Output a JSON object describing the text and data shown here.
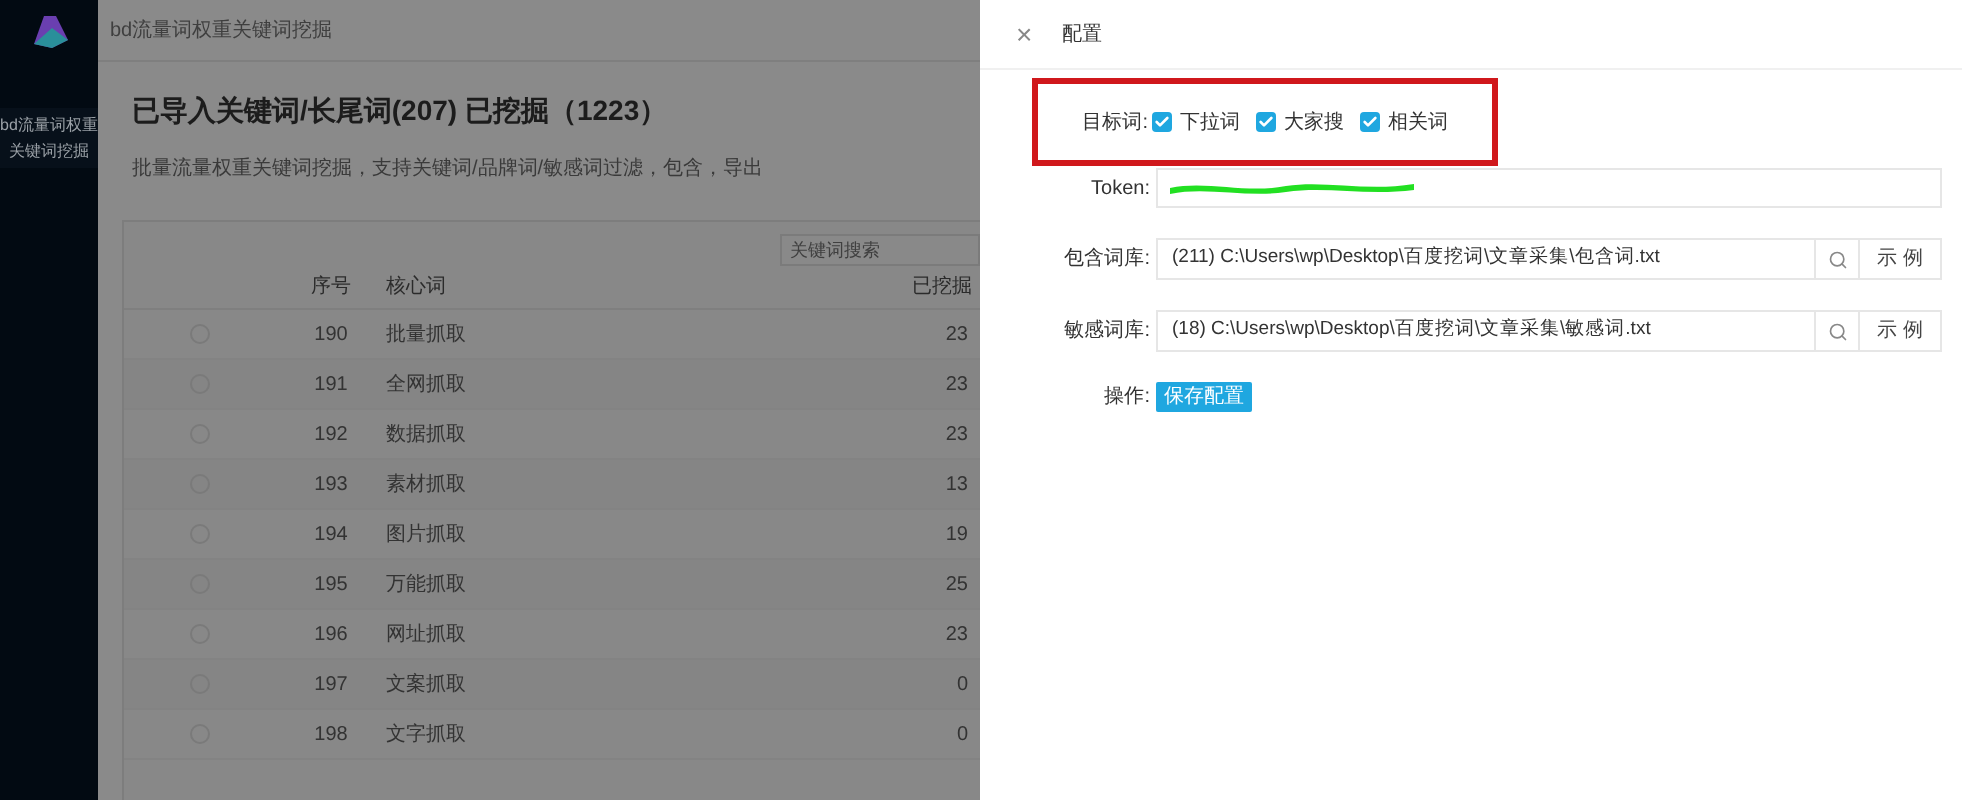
{
  "sidebar": {
    "nav_items": [
      {
        "label": "bd流量词权重关键词挖掘",
        "selected": true
      }
    ]
  },
  "header": {
    "title": "bd流量词权重关键词挖掘"
  },
  "page": {
    "heading": "已导入关键词/长尾词(207) 已挖掘（1223）",
    "subtitle": "批量流量权重关键词挖掘，支持关键词/品牌词/敏感词过滤，包含，导出"
  },
  "search": {
    "placeholder": "关键词搜索"
  },
  "table": {
    "columns": [
      "序号",
      "核心词",
      "已挖掘"
    ],
    "rows": [
      {
        "index": "190",
        "keyword": "批量抓取",
        "mined": "23",
        "selected": false
      },
      {
        "index": "191",
        "keyword": "全网抓取",
        "mined": "23",
        "selected": false
      },
      {
        "index": "192",
        "keyword": "数据抓取",
        "mined": "23",
        "selected": false
      },
      {
        "index": "193",
        "keyword": "素材抓取",
        "mined": "13",
        "selected": false
      },
      {
        "index": "194",
        "keyword": "图片抓取",
        "mined": "19",
        "selected": false
      },
      {
        "index": "195",
        "keyword": "万能抓取",
        "mined": "25",
        "selected": false
      },
      {
        "index": "196",
        "keyword": "网址抓取",
        "mined": "23",
        "selected": false
      },
      {
        "index": "197",
        "keyword": "文案抓取",
        "mined": "0",
        "selected": false
      },
      {
        "index": "198",
        "keyword": "文字抓取",
        "mined": "0",
        "selected": false
      }
    ]
  },
  "drawer": {
    "close": "×",
    "title": "配置",
    "target": {
      "label": "目标词:",
      "options": [
        {
          "label": "下拉词",
          "checked": true
        },
        {
          "label": "大家搜",
          "checked": true
        },
        {
          "label": "相关词",
          "checked": true
        }
      ]
    },
    "token": {
      "label": "Token:"
    },
    "files": [
      {
        "label": "包含词库:",
        "value": "(211) C:\\Users\\wp\\Desktop\\百度挖词\\文章采集\\包含词.txt",
        "example": "示 例"
      },
      {
        "label": "敏感词库:",
        "value": "(18) C:\\Users\\wp\\Desktop\\百度挖词\\文章采集\\敏感词.txt",
        "example": "示 例"
      }
    ],
    "action": {
      "label": "操作:",
      "button": "保存配置"
    }
  }
}
